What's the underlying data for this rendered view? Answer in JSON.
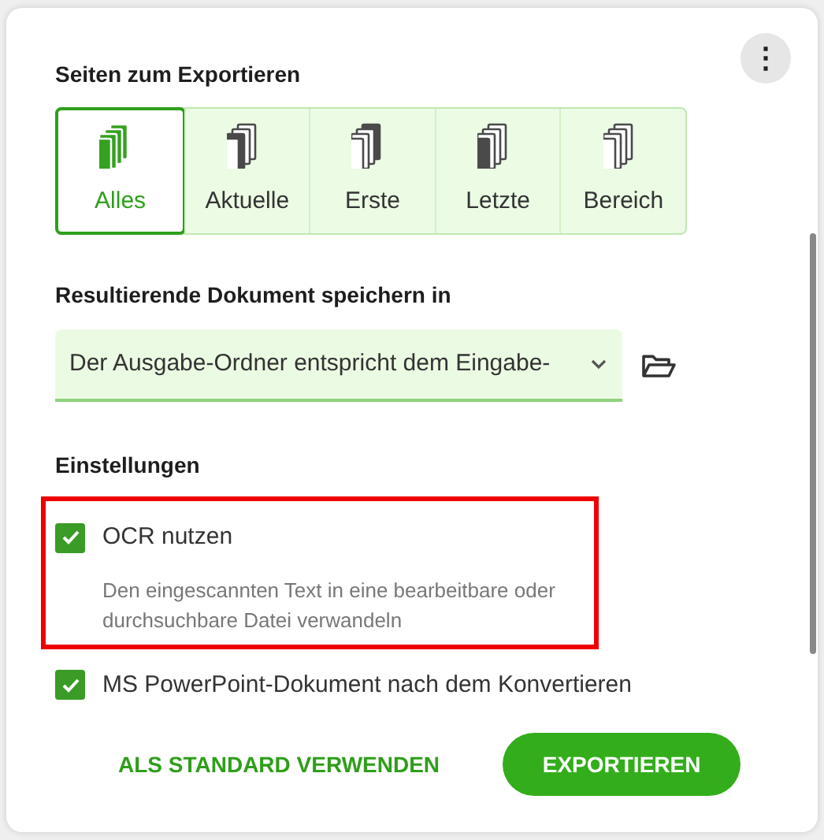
{
  "menu_button": {
    "label": "⋮"
  },
  "pages_section": {
    "title": "Seiten zum Exportieren",
    "options": [
      {
        "label": "Alles",
        "kind": "all",
        "selected": true
      },
      {
        "label": "Aktuelle",
        "kind": "current",
        "selected": false
      },
      {
        "label": "Erste",
        "kind": "first",
        "selected": false
      },
      {
        "label": "Letzte",
        "kind": "last",
        "selected": false
      },
      {
        "label": "Bereich",
        "kind": "range",
        "selected": false
      }
    ]
  },
  "save_section": {
    "title": "Resultierende Dokument speichern in",
    "dropdown": {
      "value": "Der Ausgabe-Ordner entspricht dem Eingabe-"
    }
  },
  "settings_section": {
    "title": "Einstellungen",
    "items": [
      {
        "label": "OCR nutzen",
        "checked": true,
        "highlighted": true,
        "description": "Den eingescannten Text in eine bearbeitbare oder durchsuchbare Datei verwandeln"
      },
      {
        "label": "MS PowerPoint-Dokument nach dem Konvertieren",
        "checked": true,
        "highlighted": false
      }
    ]
  },
  "buttons": [
    {
      "label": "ALS STANDARD VERWENDEN",
      "kind": "link"
    },
    {
      "label": "EXPORTIEREN",
      "kind": "primary"
    }
  ]
}
